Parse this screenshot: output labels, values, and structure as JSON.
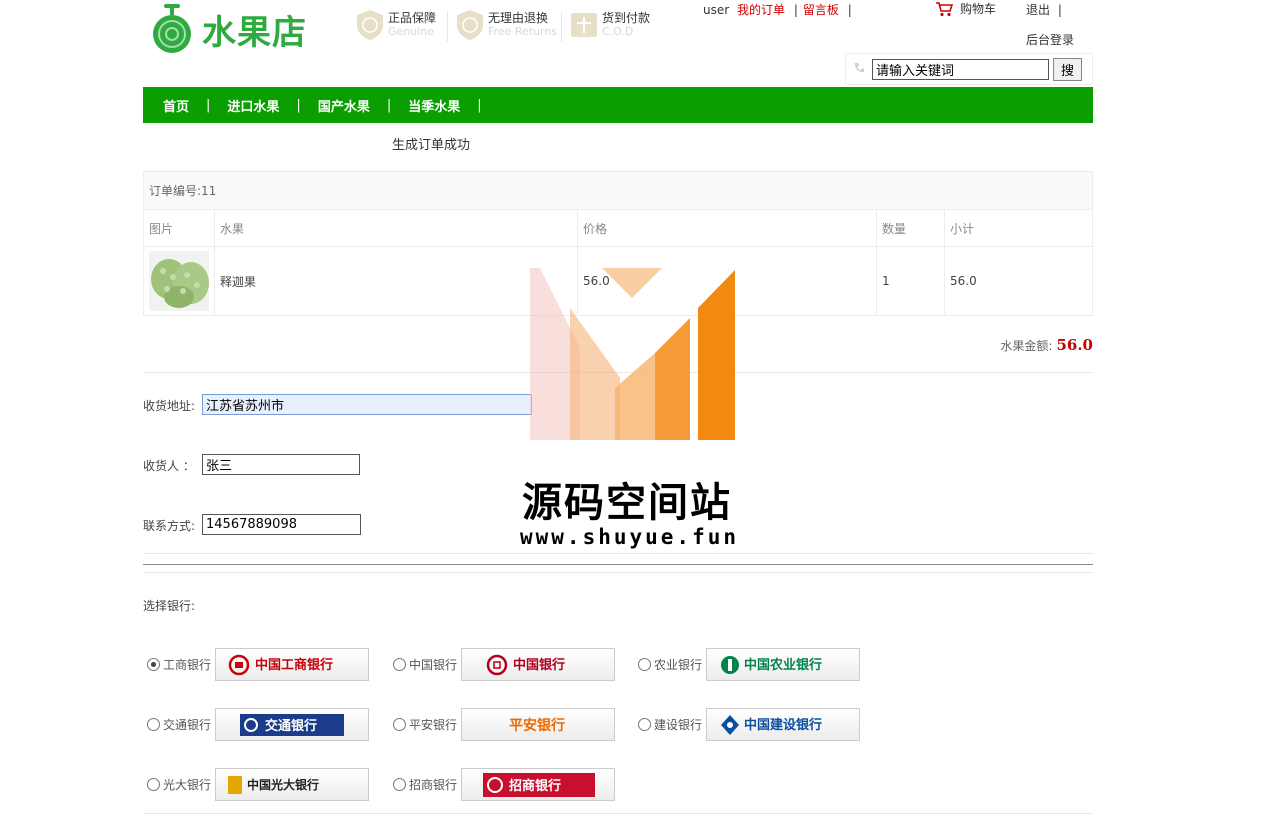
{
  "header": {
    "logo_text": "水果店",
    "promos": [
      {
        "zh": "正品保障",
        "en": "Genuine",
        "icon": "genuine-badge-icon"
      },
      {
        "zh": "无理由退换",
        "en": "Free Returns",
        "icon": "returns-badge-icon"
      },
      {
        "zh": "货到付款",
        "en": "C.O.D",
        "icon": "cod-badge-icon"
      }
    ],
    "user": "user",
    "my_orders": "我的订单",
    "message_board": "留言板",
    "sep": "|",
    "cart": "购物车",
    "logout": "退出",
    "admin_login": "后台登录",
    "search_placeholder": "请输入关键词",
    "search_button": "搜"
  },
  "nav": {
    "items": [
      "首页",
      "进口水果",
      "国产水果",
      "当季水果"
    ],
    "sep": "|"
  },
  "order": {
    "success_msg": "生成订单成功",
    "order_no_label": "订单编号:11",
    "columns": [
      "图片",
      "水果",
      "价格",
      "数量",
      "小计"
    ],
    "items": [
      {
        "name": "释迦果",
        "price": "56.0",
        "qty": "1",
        "subtotal": "56.0"
      }
    ],
    "total_label": "水果金额:",
    "total_value": "56.0"
  },
  "form": {
    "address_label": "收货地址:",
    "address_value": "江苏省苏州市",
    "receiver_label": "收货人  ：",
    "receiver_value": "张三",
    "contact_label": "联系方式:",
    "contact_value": "14567889098"
  },
  "bank": {
    "title": "选择银行:",
    "options": [
      {
        "name": "工商银行",
        "selected": true,
        "logo_text": "中国工商银行",
        "color": "#c7000b"
      },
      {
        "name": "中国银行",
        "selected": false,
        "logo_text": "中国银行",
        "color": "#b0001e"
      },
      {
        "name": "农业银行",
        "selected": false,
        "logo_text": "中国农业银行",
        "color": "#00844a"
      },
      {
        "name": "交通银行",
        "selected": false,
        "logo_text": "交通银行",
        "color": "#1a3c8a"
      },
      {
        "name": "平安银行",
        "selected": false,
        "logo_text": "平安银行",
        "color": "#ef6a00"
      },
      {
        "name": "建设银行",
        "selected": false,
        "logo_text": "中国建设银行",
        "color": "#0a4ea1"
      },
      {
        "name": "光大银行",
        "selected": false,
        "logo_text": "中国光大银行",
        "color": "#e6a800"
      },
      {
        "name": "招商银行",
        "selected": false,
        "logo_text": "招商银行",
        "color": "#c8102e"
      }
    ]
  },
  "watermark": {
    "title": "源码空间站",
    "url": "www.shuyue.fun"
  },
  "colors": {
    "brand_green": "#0a9e00",
    "price_red": "#c40000",
    "link_red": "#d20000"
  }
}
